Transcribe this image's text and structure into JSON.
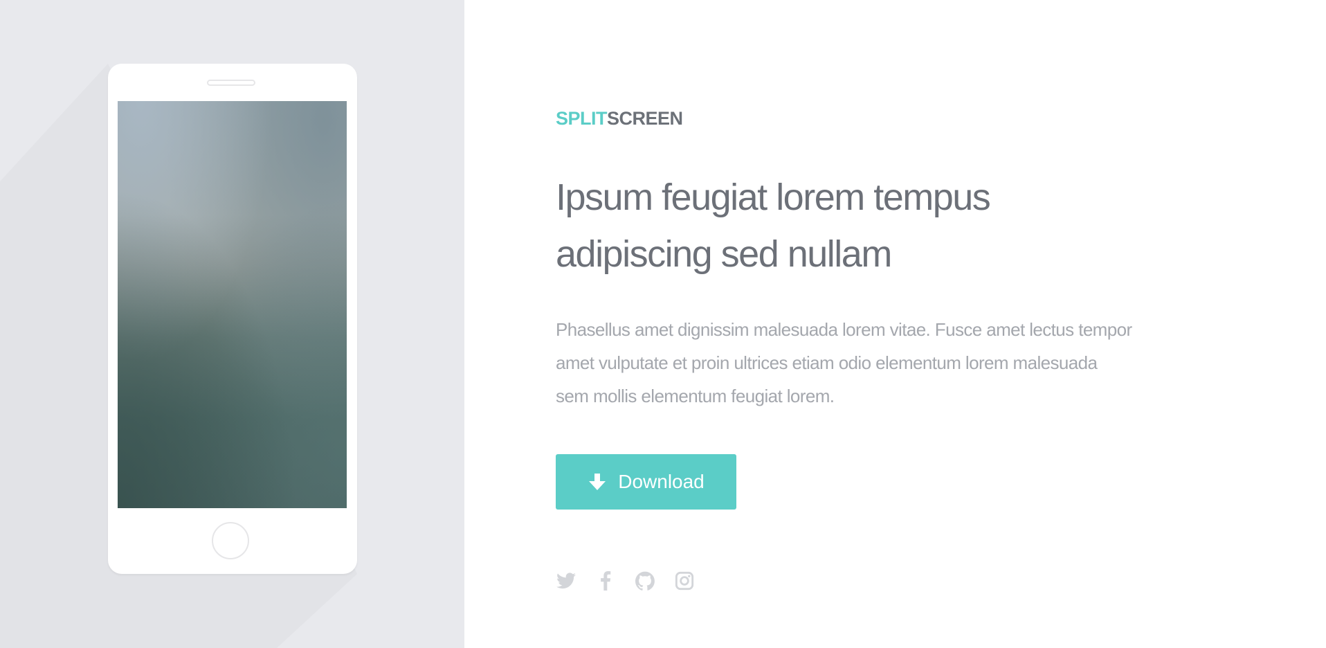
{
  "brand": {
    "split": "SPLIT",
    "screen": "SCREEN",
    "accent_color": "#5bcdc7"
  },
  "hero": {
    "headline_line1": "Ipsum feugiat lorem tempus",
    "headline_line2": "adipiscing sed nullam",
    "description_line1": "Phasellus amet dignissim malesuada lorem vitae. Fusce amet lectus tempor",
    "description_line2": "amet vulputate et proin ultrices etiam odio elementum lorem malesuada",
    "description_line3": "sem mollis elementum feugiat lorem."
  },
  "cta": {
    "download_label": "Download",
    "icon": "arrow-down-icon"
  },
  "socials": [
    {
      "icon": "twitter-icon"
    },
    {
      "icon": "facebook-icon"
    },
    {
      "icon": "github-icon"
    },
    {
      "icon": "instagram-icon"
    }
  ],
  "colors": {
    "left_panel_bg": "#e8e9ed",
    "headline": "#6c7078",
    "body_text": "#a4a7ad",
    "social_icon": "#d3d5d9"
  }
}
